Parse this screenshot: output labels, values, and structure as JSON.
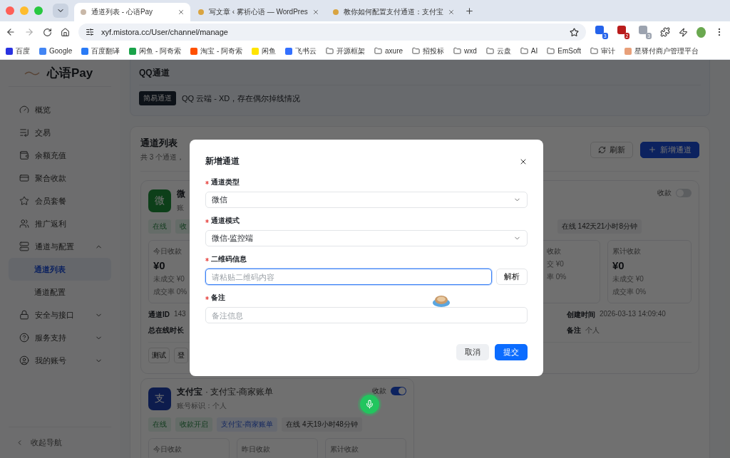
{
  "browser": {
    "tabs": [
      {
        "title": "通道列表 - 心语Pay",
        "selected": true
      },
      {
        "title": "写文章 ‹ 雾祈心语 — WordPres",
        "selected": false
      },
      {
        "title": "教你如何配置支付通道：支付宝",
        "selected": false
      }
    ],
    "address": "xyf.mistora.cc/User/channel/manage",
    "extensions": [
      {
        "badge": "3",
        "color": "#2563eb"
      },
      {
        "badge": "2",
        "color": "#b91c1c"
      },
      {
        "badge": "3",
        "color": "#9ca3af"
      }
    ],
    "bookmarks": [
      {
        "label": "百度",
        "kind": "site",
        "color": "#2932e1"
      },
      {
        "label": "Google",
        "kind": "site",
        "color": "#4285f4"
      },
      {
        "label": "百度翻译",
        "kind": "site",
        "color": "#2a7bf6"
      },
      {
        "label": "闲鱼 - 阿奇索",
        "kind": "site",
        "color": "#1aa34a"
      },
      {
        "label": "淘宝 - 阿奇索",
        "kind": "site",
        "color": "#ff5000"
      },
      {
        "label": "闲鱼",
        "kind": "site",
        "color": "#ffe400"
      },
      {
        "label": "飞书云",
        "kind": "site",
        "color": "#3370ff"
      },
      {
        "label": "开源框架",
        "kind": "folder"
      },
      {
        "label": "axure",
        "kind": "folder"
      },
      {
        "label": "招投标",
        "kind": "folder"
      },
      {
        "label": "wxd",
        "kind": "folder"
      },
      {
        "label": "云盘",
        "kind": "folder"
      },
      {
        "label": "AI",
        "kind": "folder"
      },
      {
        "label": "EmSoft",
        "kind": "folder"
      },
      {
        "label": "审计",
        "kind": "folder"
      },
      {
        "label": "星驿付商户管理平台",
        "kind": "site",
        "color": "#e8a07a"
      }
    ]
  },
  "sidebar": {
    "brand": "心语Pay",
    "items": [
      {
        "label": "概览",
        "selected": false
      },
      {
        "label": "交易",
        "selected": false
      },
      {
        "label": "余额充值",
        "selected": false
      },
      {
        "label": "聚合收款",
        "selected": false
      },
      {
        "label": "会员套餐",
        "selected": false
      },
      {
        "label": "推广返利",
        "selected": false
      },
      {
        "label": "通道与配置",
        "selected": false,
        "expanded": true,
        "children": [
          {
            "label": "通道列表",
            "selected": true
          },
          {
            "label": "通道配置",
            "selected": false
          }
        ]
      },
      {
        "label": "安全与接口",
        "selected": false,
        "expanded": false
      },
      {
        "label": "服务支持",
        "selected": false,
        "expanded": false
      },
      {
        "label": "我的账号",
        "selected": false,
        "expanded": false
      }
    ],
    "collapse": "收起导航"
  },
  "notice": {
    "title": "QQ通道",
    "tag": "简易通道",
    "text": "QQ 云端 - XD，存在偶尔掉线情况"
  },
  "channel_list": {
    "title": "通道列表",
    "subtitle": "共 3 个通道，",
    "buttons": [
      {
        "label": "刷新",
        "kind": "refresh"
      },
      {
        "label": "新增通道",
        "kind": "add"
      }
    ],
    "channels": [
      {
        "avatar": "微",
        "kind": "green",
        "name": "微",
        "account": "账",
        "toggle_label": "收款",
        "on": false,
        "tags": [
          {
            "label": "在线",
            "kind": "green"
          },
          {
            "label": "收",
            "kind": "green"
          },
          {
            "label": "在线 142天21小时8分钟",
            "kind": "gray"
          }
        ],
        "stats": [
          {
            "label": "今日收款",
            "value": "¥0",
            "lines": [
              "未成交 ¥0",
              "成交率 0%"
            ]
          },
          {
            "label": "收款",
            "lines": [
              "交 ¥0",
              "率 0%"
            ]
          },
          {
            "label": "累计收款",
            "value": "¥0",
            "lines": [
              "未成交 ¥0",
              "成交率 0%"
            ]
          }
        ],
        "info_left": [
          {
            "label": "通道ID",
            "value": "143"
          },
          {
            "label": "总在线时长"
          }
        ],
        "info_right": [
          {
            "label": "创建时间",
            "value": "2026-03-13 14:09:40"
          },
          {
            "label": "备注",
            "value": "个人"
          }
        ],
        "actions": [
          "测试",
          "登"
        ]
      },
      {
        "avatar": "支",
        "kind": "blue",
        "name": "支付宝",
        "suffix": "· 支付宝-商家账单",
        "account": "账号标识：个人",
        "toggle_label": "收款",
        "on": true,
        "tags": [
          {
            "label": "在线",
            "kind": "green"
          },
          {
            "label": "收款开启",
            "kind": "green"
          },
          {
            "label": "支付宝-商家账单",
            "kind": "blue"
          },
          {
            "label": "在线 4天19小时48分钟",
            "kind": "gray"
          }
        ],
        "stats": [
          {
            "label": "今日收款"
          },
          {
            "label": "昨日收款"
          },
          {
            "label": "累计收款"
          }
        ]
      }
    ]
  },
  "dialog": {
    "title": "新增通道",
    "fields": [
      {
        "label": "通道类型",
        "required": true,
        "kind": "select",
        "value": "微信"
      },
      {
        "label": "通道模式",
        "required": true,
        "kind": "select",
        "value": "微信-监控端"
      },
      {
        "label": "二维码信息",
        "required": true,
        "kind": "input",
        "placeholder": "请粘贴二维码内容",
        "focused": true,
        "action": "解析"
      },
      {
        "label": "备注",
        "required": true,
        "kind": "input",
        "placeholder": "备注信息",
        "focused": false
      }
    ],
    "buttons": [
      {
        "label": "取消",
        "kind": "secondary"
      },
      {
        "label": "提交",
        "kind": "primary"
      }
    ]
  }
}
